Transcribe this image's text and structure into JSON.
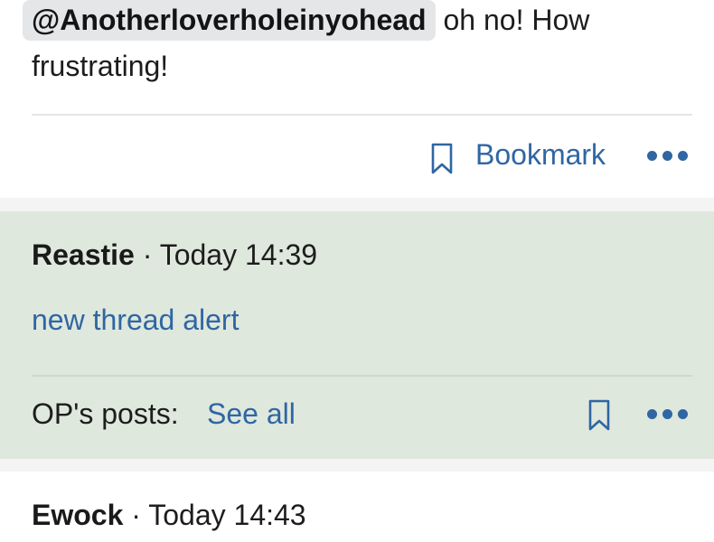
{
  "posts": [
    {
      "mention": "@Anotherloverholeinyohead",
      "text_after_mention": " oh no! How",
      "text_line2": "frustrating!",
      "actions": {
        "bookmark_label": "Bookmark",
        "bookmark_icon": "bookmark-outline-icon",
        "more_icon": "more-dots-icon"
      }
    },
    {
      "author": "Reastie",
      "separator": " · ",
      "timestamp": "Today 14:39",
      "body_link": "new thread alert",
      "op_posts_label": "OP's posts:",
      "op_posts_link": "See all",
      "actions": {
        "bookmark_icon": "bookmark-outline-icon",
        "more_icon": "more-dots-icon"
      },
      "background_color": "#dfe8dd"
    },
    {
      "author": "Ewock",
      "separator": " · ",
      "timestamp": "Today 14:43"
    }
  ],
  "colors": {
    "link": "#2f66a3",
    "text": "#1d1d1d",
    "mention_bg": "#e4e6e8",
    "page_bg": "#f4f4f4"
  }
}
